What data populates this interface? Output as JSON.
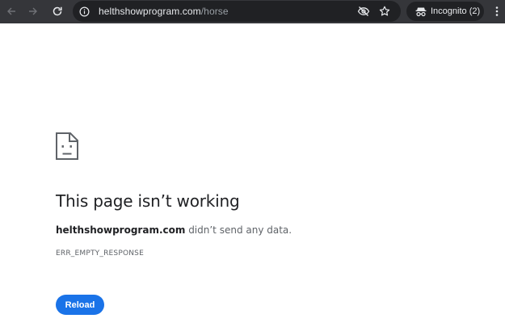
{
  "browser": {
    "url_host": "helthshowprogram.com",
    "url_path": "/horse",
    "incognito_label": "Incognito (2)",
    "icons": {
      "back": "back-arrow-icon",
      "forward": "forward-arrow-icon",
      "reload": "reload-icon",
      "site_info": "info-icon",
      "eye": "eye-off-icon",
      "star": "star-icon",
      "incognito": "incognito-icon",
      "menu": "kebab-menu-icon"
    }
  },
  "error": {
    "icon": "sad-page-icon",
    "title": "This page isn’t working",
    "host": "helthshowprogram.com",
    "message": " didn’t send any data.",
    "code": "ERR_EMPTY_RESPONSE",
    "button_label": "Reload"
  },
  "colors": {
    "toolbar": "#35363a",
    "omnibox": "#202124",
    "button": "#1a73e8"
  }
}
